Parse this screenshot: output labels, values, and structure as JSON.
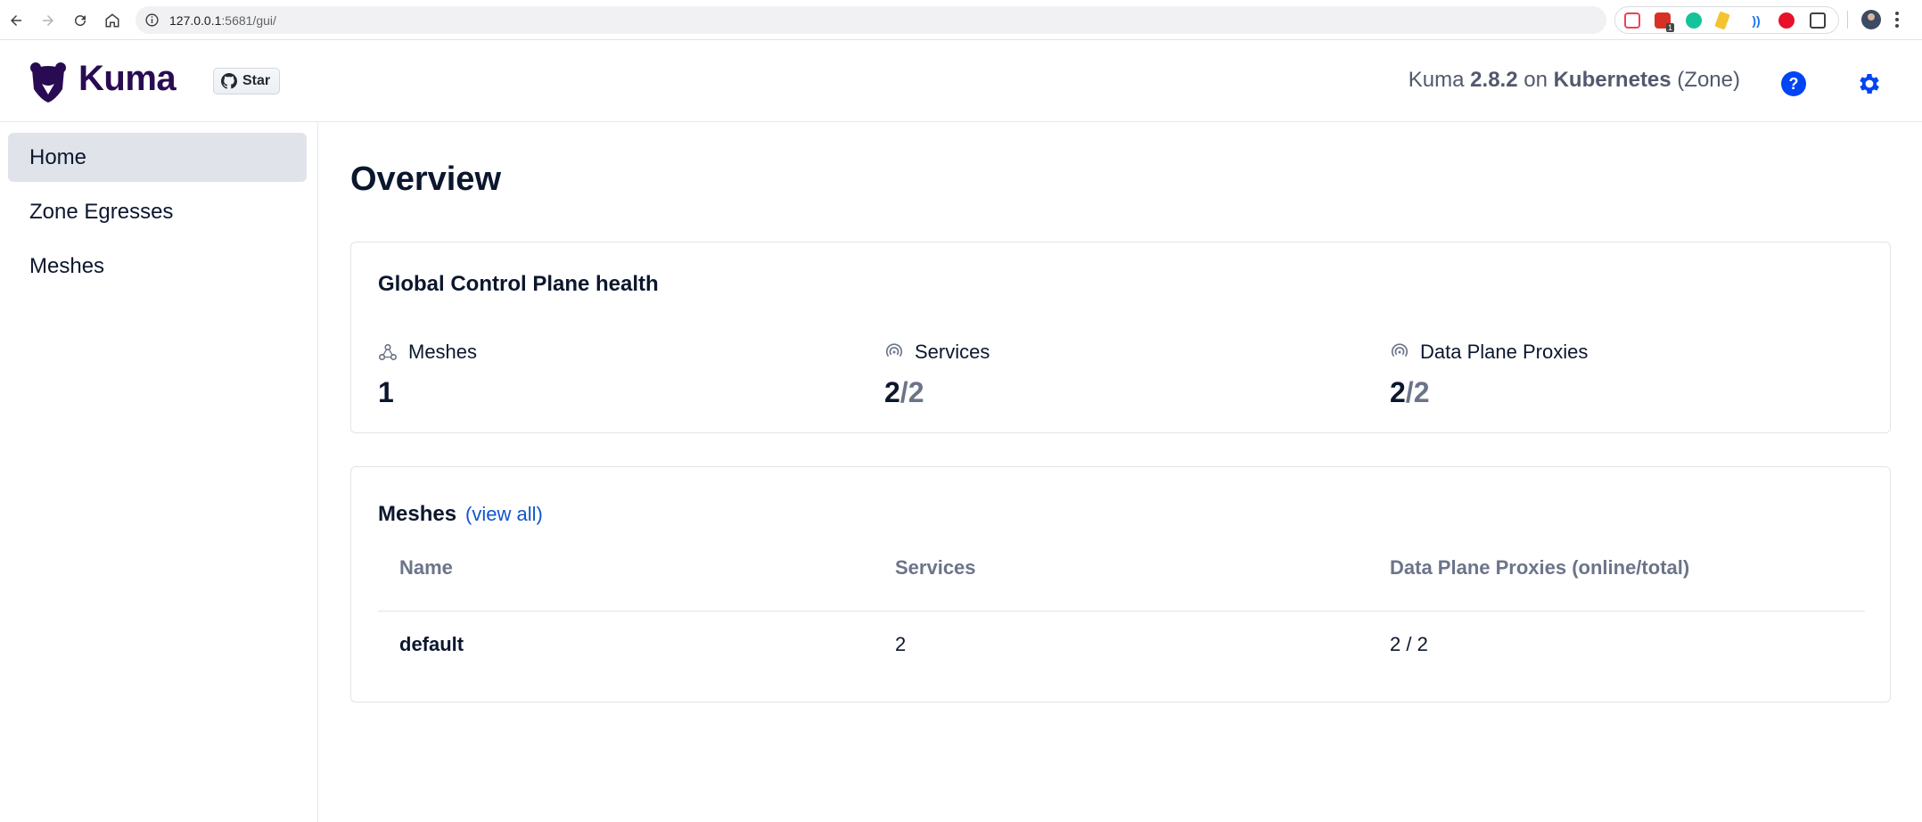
{
  "browser": {
    "url_host": "127.0.0.1",
    "url_rest": ":5681/gui/",
    "extensions": [
      "pocket-icon",
      "calendar-extension-icon",
      "grammarly-icon",
      "broom-icon",
      "wifi-signal-icon",
      "opera-icon",
      "puzzle-icon"
    ],
    "extension_badge": "1"
  },
  "header": {
    "logo_text": "Kuma",
    "github_star_label": "Star",
    "version_prefix": "Kuma ",
    "version": "2.8.2",
    "version_on": " on ",
    "environment": "Kubernetes",
    "mode": " (Zone)",
    "help_label": "?"
  },
  "sidebar": {
    "items": [
      {
        "label": "Home",
        "active": true
      },
      {
        "label": "Zone Egresses",
        "active": false
      },
      {
        "label": "Meshes",
        "active": false
      }
    ]
  },
  "main": {
    "title": "Overview",
    "health": {
      "title": "Global Control Plane health",
      "stats": [
        {
          "label": "Meshes",
          "value": "1",
          "total": ""
        },
        {
          "label": "Services",
          "value": "2",
          "total": "/2"
        },
        {
          "label": "Data Plane Proxies",
          "value": "2",
          "total": "/2"
        }
      ]
    },
    "meshes": {
      "title": "Meshes",
      "view_all": "(view all)",
      "columns": [
        "Name",
        "Services",
        "Data Plane Proxies (online/total)"
      ],
      "rows": [
        {
          "name": "default",
          "services": "2",
          "proxies": "2 / 2"
        }
      ]
    }
  },
  "colors": {
    "brand": "#290b53",
    "accent": "#0044f4",
    "link": "#1155cb",
    "active_bg": "#e0e4ea"
  }
}
